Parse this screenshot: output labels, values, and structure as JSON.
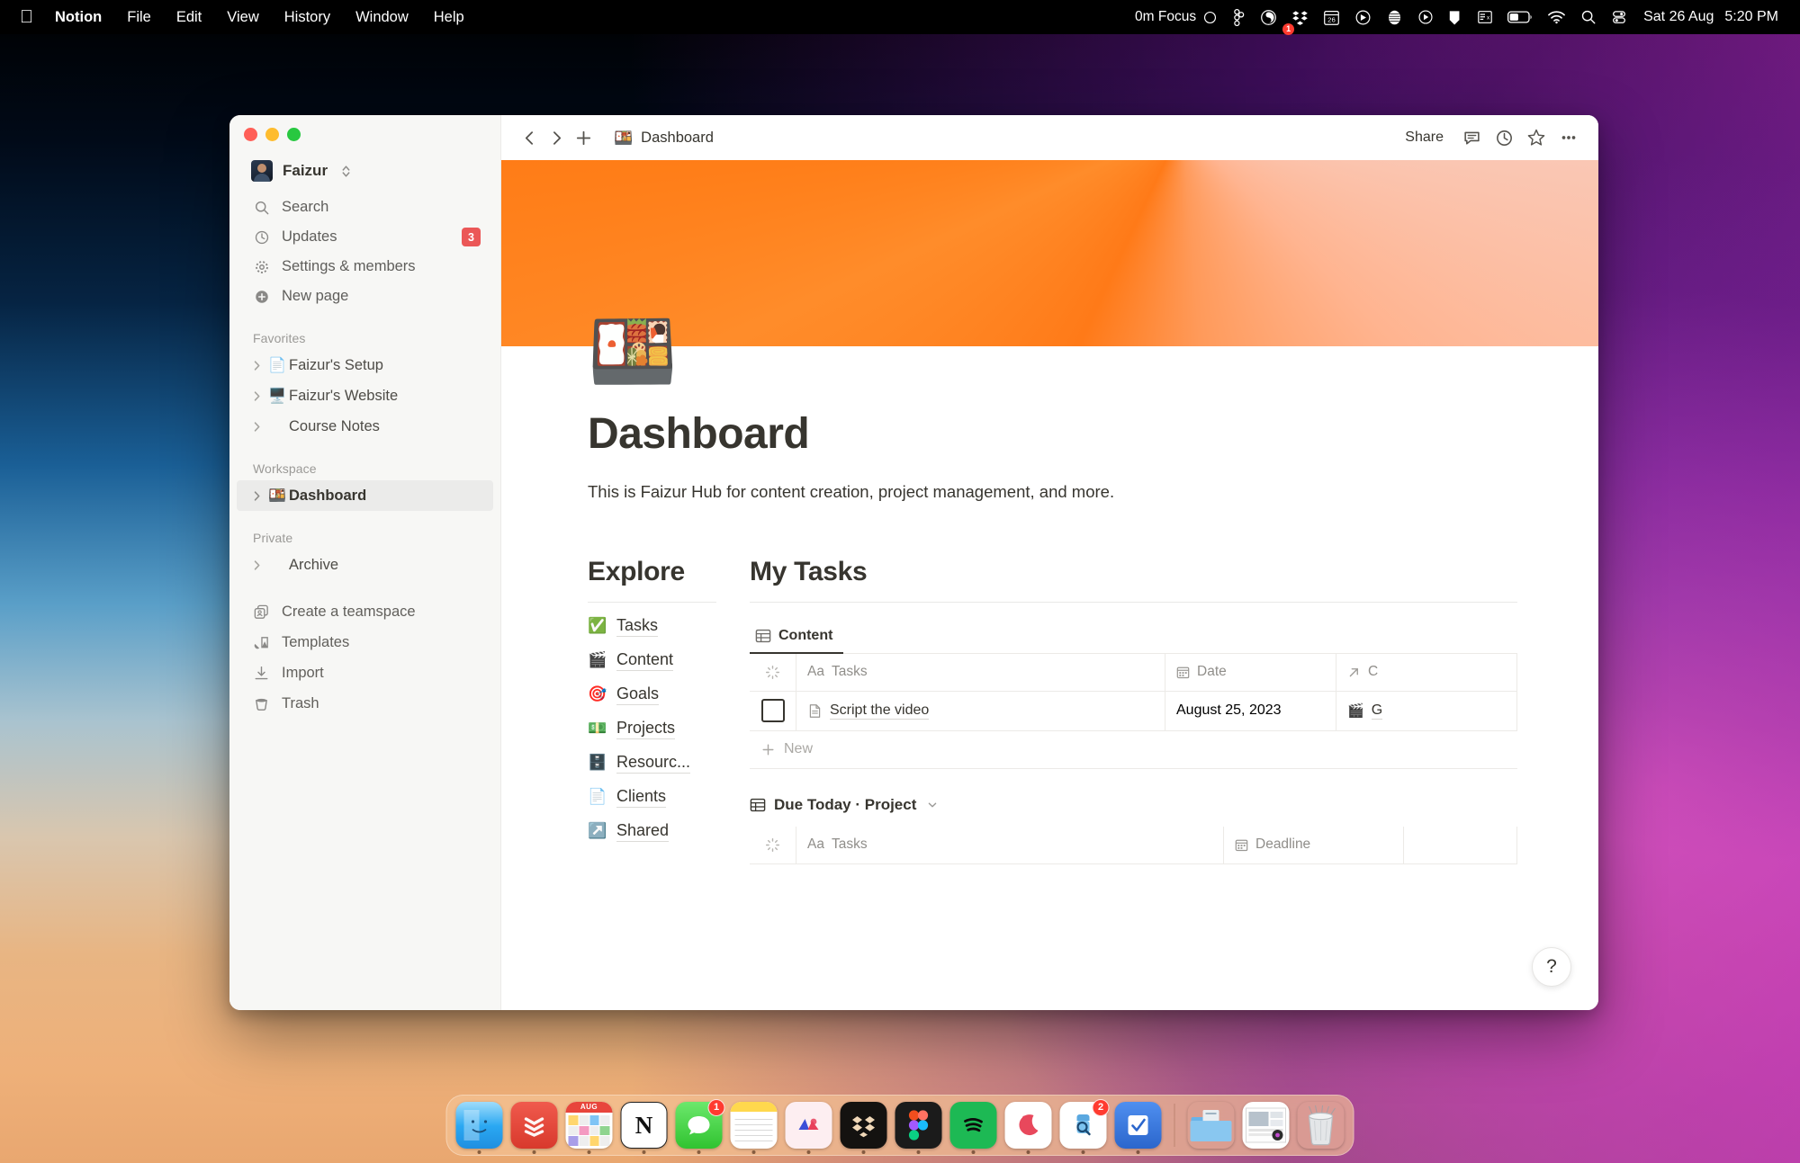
{
  "menubar": {
    "apple_icon": "apple-logo",
    "app_name": "Notion",
    "menus": [
      "File",
      "Edit",
      "View",
      "History",
      "Window",
      "Help"
    ],
    "focus_label": "0m Focus",
    "status_icons": [
      "figma-icon",
      "bartender-icon",
      "dropbox-icon",
      "calendar-26-icon",
      "cleanshot-icon",
      "grammarly-icon",
      "quicktime-icon",
      "notion-icon",
      "numi-icon",
      "battery-icon",
      "wifi-icon",
      "spotlight-icon",
      "controlcenter-icon"
    ],
    "dropbox_badge": "1",
    "calendar_day": "26",
    "clock": "Sat 26 Aug  5:20 PM",
    "date_text": "Sat 26 Aug",
    "time_text": "5:20 PM"
  },
  "window": {
    "traffic_lights": [
      "close",
      "minimize",
      "zoom"
    ]
  },
  "sidebar": {
    "workspace": {
      "name": "Faizur",
      "avatar": "user-avatar",
      "chevron": "chevron-updown-icon"
    },
    "quick_items": [
      {
        "label": "Search",
        "icon": "search-icon"
      },
      {
        "label": "Updates",
        "icon": "clock-icon",
        "badge": "3"
      },
      {
        "label": "Settings & members",
        "icon": "gear-icon"
      },
      {
        "label": "New page",
        "icon": "plus-circle-icon"
      }
    ],
    "favorites_title": "Favorites",
    "favorites": [
      {
        "label": "Faizur's Setup",
        "emoji": "📄"
      },
      {
        "label": "Faizur's Website",
        "emoji": "🖥️"
      },
      {
        "label": "Course Notes",
        "emoji": ""
      }
    ],
    "workspace_title": "Workspace",
    "workspace_items": [
      {
        "label": "Dashboard",
        "emoji": "🍱",
        "selected": true
      }
    ],
    "private_title": "Private",
    "private_items": [
      {
        "label": "Archive",
        "emoji": ""
      }
    ],
    "bottom_items": [
      {
        "label": "Create a teamspace",
        "icon": "teamspace-icon"
      },
      {
        "label": "Templates",
        "icon": "templates-icon"
      },
      {
        "label": "Import",
        "icon": "import-icon"
      },
      {
        "label": "Trash",
        "icon": "trash-icon"
      }
    ]
  },
  "topbar": {
    "back_icon": "chevron-left-icon",
    "forward_icon": "chevron-right-icon",
    "new_icon": "plus-icon",
    "breadcrumb_emoji": "🍱",
    "breadcrumb_label": "Dashboard",
    "share_label": "Share",
    "comment_icon": "comment-icon",
    "history_icon": "clock-icon",
    "favorite_icon": "star-icon",
    "more_icon": "more-horizontal-icon"
  },
  "page": {
    "cover": "orange-red-gradient-cover",
    "emoji": "🍱",
    "title": "Dashboard",
    "description": "This is Faizur Hub for content creation, project management, and more."
  },
  "explore": {
    "heading": "Explore",
    "items": [
      {
        "label": "Tasks",
        "emoji": "✅",
        "icon": "check-badge-icon"
      },
      {
        "label": "Content",
        "emoji": "🎬",
        "icon": "clapperboard-icon"
      },
      {
        "label": "Goals",
        "emoji": "🎯",
        "icon": "target-icon"
      },
      {
        "label": "Projects",
        "emoji": "💵",
        "icon": "money-icon"
      },
      {
        "label": "Resourc...",
        "emoji": "🗄️",
        "icon": "server-icon"
      },
      {
        "label": "Clients",
        "emoji": "📄",
        "icon": "page-icon"
      },
      {
        "label": "Shared",
        "emoji": "↗️",
        "icon": "arrow-up-right-icon"
      }
    ]
  },
  "my_tasks": {
    "heading": "My Tasks",
    "tab": {
      "label": "Content",
      "icon": "table-icon"
    },
    "columns": [
      {
        "label": "Tasks",
        "type_icon": "Aa"
      },
      {
        "label": "Date",
        "type_icon": "calendar-icon"
      },
      {
        "label": "C",
        "type_icon": "relation-icon"
      }
    ],
    "rows": [
      {
        "checked": false,
        "name": "Script the video",
        "name_icon": "page-icon",
        "date": "August 25, 2023",
        "relation": "G",
        "relation_emoji": "🎬"
      }
    ],
    "new_label": "New",
    "new_icon": "plus-icon"
  },
  "due_today": {
    "title": "Due Today · Project",
    "icon": "table-icon",
    "chevron": "chevron-down-icon",
    "columns": [
      {
        "label": "Tasks",
        "type_icon": "Aa"
      },
      {
        "label": "Deadline",
        "type_icon": "calendar-icon"
      }
    ],
    "rows": []
  },
  "help": {
    "label": "?",
    "name": "help-button"
  },
  "dock": {
    "apps": [
      {
        "name": "finder",
        "emoji": "🙂",
        "bg": "#1f9cf0",
        "running": true
      },
      {
        "name": "todoist",
        "emoji": "»",
        "bg": "#e44332",
        "running": true
      },
      {
        "name": "calendar",
        "emoji": "🗓️",
        "bg": "#ffffff",
        "running": true,
        "label": "AUG"
      },
      {
        "name": "notion",
        "emoji": "N",
        "bg": "#ffffff",
        "running": true
      },
      {
        "name": "messages",
        "emoji": "💬",
        "bg": "#4cd964",
        "running": true,
        "badge": "1"
      },
      {
        "name": "notes",
        "emoji": "📒",
        "bg": "#ffffff",
        "running": true
      },
      {
        "name": "affinity",
        "emoji": "✦",
        "bg": "#fce8ee",
        "running": true
      },
      {
        "name": "dropbox",
        "emoji": "❖",
        "bg": "#12100e",
        "running": true
      },
      {
        "name": "figma",
        "emoji": "◉",
        "bg": "#1a1a1a",
        "running": true
      },
      {
        "name": "spotify",
        "emoji": "♫",
        "bg": "#1db954",
        "running": true
      },
      {
        "name": "bear",
        "emoji": "🌙",
        "bg": "#ffffff",
        "running": true
      },
      {
        "name": "downie",
        "emoji": "🔍",
        "bg": "#ffffff",
        "running": true,
        "badge": "2"
      },
      {
        "name": "things",
        "emoji": "✔",
        "bg": "#2e6fd9",
        "running": true
      },
      {
        "name": "separator",
        "emoji": "",
        "bg": "",
        "running": false
      },
      {
        "name": "downloads-folder",
        "emoji": "📁",
        "bg": "#5aa9e6",
        "running": false
      },
      {
        "name": "screenshot-file",
        "emoji": "🖼️",
        "bg": "#ffffff",
        "running": false
      },
      {
        "name": "trash",
        "emoji": "🗑️",
        "bg": "#e7e7e7",
        "running": false
      }
    ]
  }
}
